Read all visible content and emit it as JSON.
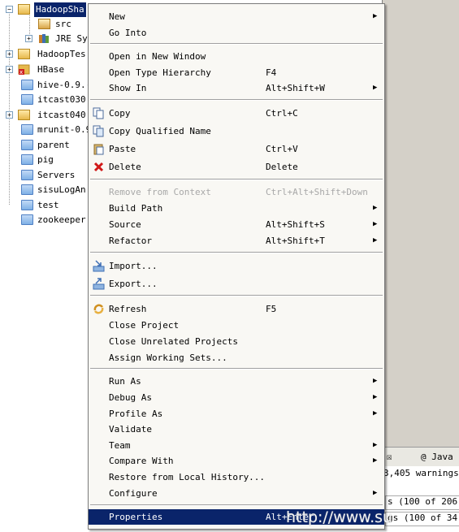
{
  "tree": {
    "items": [
      {
        "label": "HadoopSha",
        "kind": "project",
        "expander": "−",
        "selected": true
      },
      {
        "label": "src",
        "kind": "package"
      },
      {
        "label": "JRE Sy",
        "kind": "library",
        "expander": "+"
      },
      {
        "label": "HadoopTes",
        "kind": "project",
        "expander": "+"
      },
      {
        "label": "HBase",
        "kind": "project",
        "expander": "+"
      },
      {
        "label": "hive-0.9.(",
        "kind": "folder"
      },
      {
        "label": "itcast030",
        "kind": "folder"
      },
      {
        "label": "itcast040",
        "kind": "project",
        "expander": "+"
      },
      {
        "label": "mrunit-0.9",
        "kind": "folder"
      },
      {
        "label": "parent",
        "kind": "folder"
      },
      {
        "label": "pig",
        "kind": "folder"
      },
      {
        "label": "Servers",
        "kind": "folder"
      },
      {
        "label": "sisuLogAn",
        "kind": "folder"
      },
      {
        "label": "test",
        "kind": "folder"
      },
      {
        "label": "zookeeper",
        "kind": "folder"
      }
    ]
  },
  "console": {
    "tab_close": "☒",
    "tab_javadoc": "@ Java",
    "summary": "3,405 warnings",
    "row1": "s (100 of 206",
    "row2": "gs (100 of 34"
  },
  "menu": {
    "new": "New",
    "go_into": "Go Into",
    "open_new_window": "Open in New Window",
    "open_type_hierarchy": "Open Type Hierarchy",
    "open_type_hierarchy_acc": "F4",
    "show_in": "Show In",
    "show_in_acc": "Alt+Shift+W",
    "copy": "Copy",
    "copy_acc": "Ctrl+C",
    "copy_qualified": "Copy Qualified Name",
    "paste": "Paste",
    "paste_acc": "Ctrl+V",
    "delete": "Delete",
    "delete_acc": "Delete",
    "remove_context": "Remove from Context",
    "remove_context_acc": "Ctrl+Alt+Shift+Down",
    "build_path": "Build Path",
    "source": "Source",
    "source_acc": "Alt+Shift+S",
    "refactor": "Refactor",
    "refactor_acc": "Alt+Shift+T",
    "import": "Import...",
    "export": "Export...",
    "refresh": "Refresh",
    "refresh_acc": "F5",
    "close_project": "Close Project",
    "close_unrelated": "Close Unrelated Projects",
    "assign_working_sets": "Assign Working Sets...",
    "run_as": "Run As",
    "debug_as": "Debug As",
    "profile_as": "Profile As",
    "validate": "Validate",
    "team": "Team",
    "compare_with": "Compare With",
    "restore_history": "Restore from Local History...",
    "configure": "Configure",
    "properties": "Properties",
    "properties_acc": "Alt+Enter",
    "submenu_arrow": "▶"
  },
  "watermark": "http://www.su",
  "colors": {
    "selection": "#0a246a",
    "menu_bg": "#f9f8f4",
    "disabled": "#a8a8a8"
  }
}
